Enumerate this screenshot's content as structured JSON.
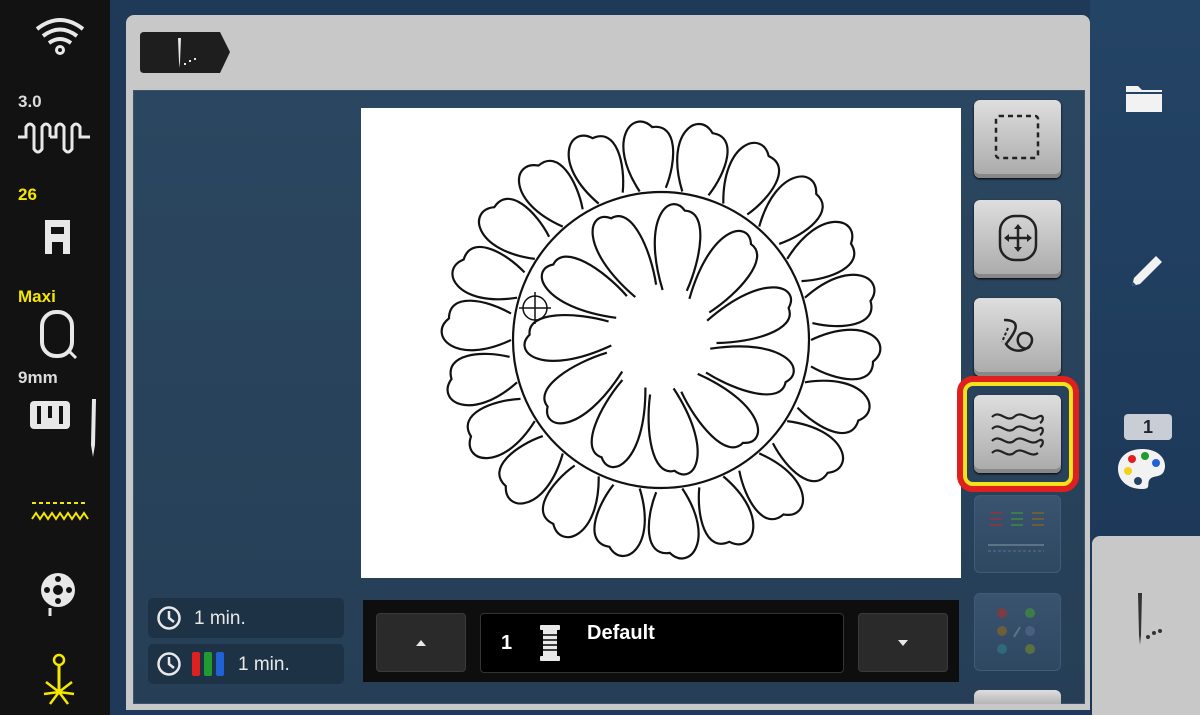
{
  "left_bar": {
    "wifi_icon": "wifi-icon",
    "stitch_width": "3.0",
    "stitch_width_icon": "stitch-pattern-icon",
    "presser_foot_number": "26",
    "presser_foot_icon": "presser-foot-icon",
    "hoop_size": "Maxi",
    "hoop_icon": "hoop-icon",
    "needle_plate": "9mm",
    "needle_plate_icon": "stitch-plate-icon",
    "needle_icon": "needle-icon",
    "feed_dog_icon": "feed-dog-icon",
    "bobbin_icon": "bobbin-icon",
    "thread_tension_icon": "needle-position-icon"
  },
  "header": {
    "tab_icon": "needle-tab-icon"
  },
  "info": {
    "stitch_time": "1 min.",
    "color_time": "1 min."
  },
  "thread_list": {
    "number": "1",
    "name": "Default"
  },
  "right_panel_buttons": [
    {
      "name": "select-area-button"
    },
    {
      "name": "move-hoop-button"
    },
    {
      "name": "check-size-button"
    },
    {
      "name": "quilt-stitch-button",
      "highlighted": true
    },
    {
      "name": "color-resequence-button",
      "disabled": true
    },
    {
      "name": "color-grid-button",
      "disabled": true
    }
  ],
  "right_bar": {
    "folder_icon": "folder-icon",
    "edit_icon": "pencil-icon",
    "palette_badge": "1",
    "palette_icon": "palette-icon",
    "sewing_icon": "needle-sewing-icon"
  },
  "colors": {
    "highlight_outer": "#e0201f",
    "highlight_inner": "#f4e31a",
    "label_yellow": "#f6e700",
    "background": "#1f3a58"
  }
}
